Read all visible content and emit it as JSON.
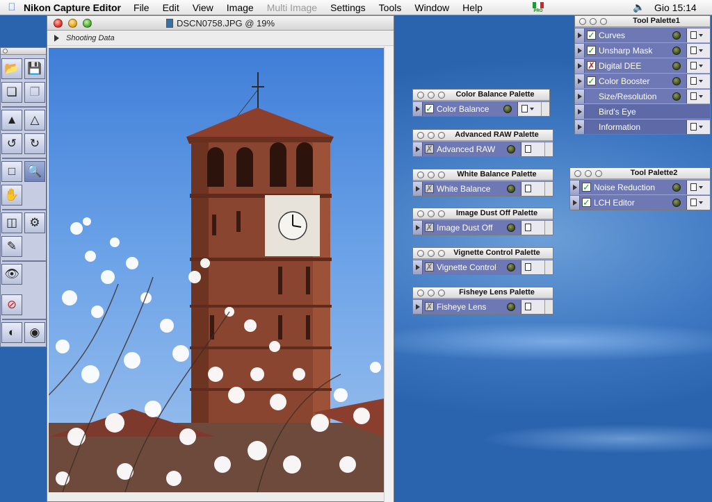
{
  "menubar": {
    "app_name": "Nikon Capture Editor",
    "items": [
      "File",
      "Edit",
      "View",
      "Image",
      "Multi Image",
      "Settings",
      "Tools",
      "Window",
      "Help"
    ],
    "disabled_item": "Multi Image",
    "flag_badge": "PRO",
    "clock": "Gio 15:14"
  },
  "image_window": {
    "title": "DSCN0758.JPG @ 19%",
    "shooting_data_label": "Shooting Data"
  },
  "tool_palette_1": {
    "title": "Tool Palette1",
    "rows": [
      {
        "label": "Curves",
        "check": "on"
      },
      {
        "label": "Unsharp Mask",
        "check": "on"
      },
      {
        "label": "Digital DEE",
        "check": "off"
      },
      {
        "label": "Color Booster",
        "check": "on"
      },
      {
        "label": "Size/Resolution",
        "check": "none"
      },
      {
        "label": "Bird's Eye",
        "check": "none"
      },
      {
        "label": "Information",
        "check": "none"
      }
    ]
  },
  "tool_palette_2": {
    "title": "Tool Palette2",
    "rows": [
      {
        "label": "Noise Reduction",
        "check": "on"
      },
      {
        "label": "LCH Editor",
        "check": "on"
      }
    ]
  },
  "palettes": [
    {
      "title": "Color Balance Palette",
      "row": "Color Balance",
      "check": "on"
    },
    {
      "title": "Advanced RAW Palette",
      "row": "Advanced RAW",
      "check": "gray"
    },
    {
      "title": "White Balance Palette",
      "row": "White Balance",
      "check": "gray"
    },
    {
      "title": "Image Dust Off Palette",
      "row": "Image Dust Off",
      "check": "gray"
    },
    {
      "title": "Vignette Control Palette",
      "row": "Vignette Control",
      "check": "gray"
    },
    {
      "title": "Fisheye Lens Palette",
      "row": "Fisheye Lens",
      "check": "gray"
    }
  ]
}
